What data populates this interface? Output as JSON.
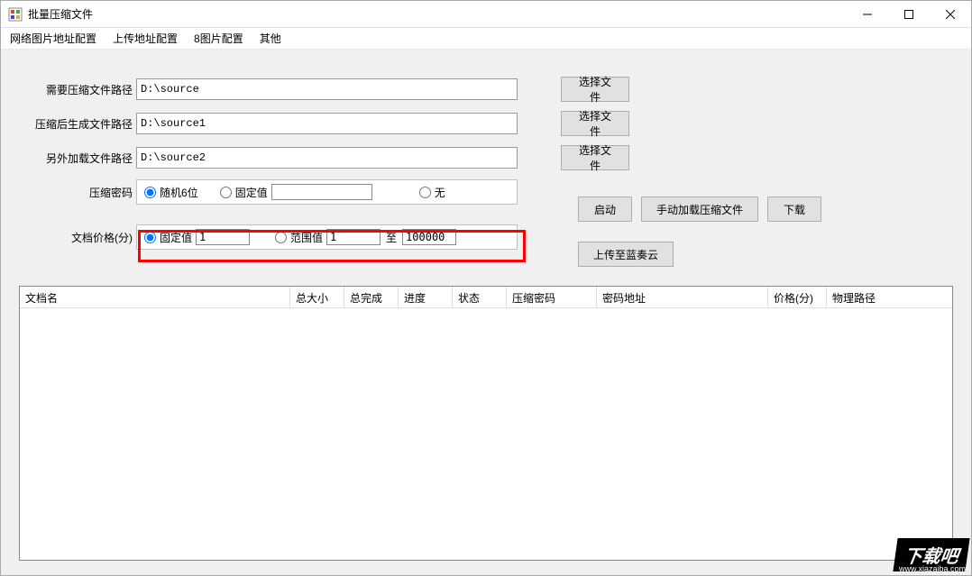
{
  "window": {
    "title": "批量压缩文件"
  },
  "menu": {
    "item1": "网络图片地址配置",
    "item2": "上传地址配置",
    "item3": "8图片配置",
    "item4": "其他"
  },
  "form": {
    "source_path_label": "需要压缩文件路径",
    "source_path_value": "D:\\source",
    "output_path_label": "压缩后生成文件路径",
    "output_path_value": "D:\\source1",
    "extra_path_label": "另外加载文件路径",
    "extra_path_value": "D:\\source2",
    "select_file_btn": "选择文件",
    "password_label": "压缩密码",
    "password_random": "随机6位",
    "password_fixed": "固定值",
    "password_fixed_value": "",
    "password_none": "无",
    "price_label": "文档价格(分)",
    "price_fixed": "固定值",
    "price_fixed_value": "1",
    "price_range": "范围值",
    "price_range_from": "1",
    "price_range_to_label": "至",
    "price_range_to": "100000"
  },
  "buttons": {
    "start": "启动",
    "manual_load": "手动加载压缩文件",
    "download": "下载",
    "upload_cloud": "上传至蓝奏云"
  },
  "table": {
    "col1": "文档名",
    "col2": "总大小",
    "col3": "总完成",
    "col4": "进度",
    "col5": "状态",
    "col6": "压缩密码",
    "col7": "密码地址",
    "col8": "价格(分)",
    "col9": "物理路径"
  },
  "watermark": {
    "text": "下载吧",
    "url": "www.xiazaiba.com"
  }
}
